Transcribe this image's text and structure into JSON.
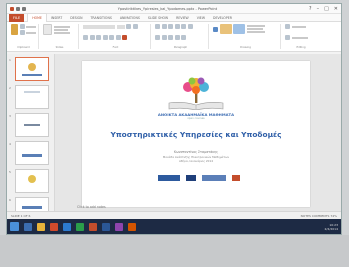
{
  "window": {
    "title": "Ypostiriktikes_Ypiresies_kai_Ypodomes.pptx - PowerPoint",
    "controls": [
      "?",
      "–",
      "□",
      "✕"
    ]
  },
  "ribbon": {
    "tabs": [
      "FILE",
      "HOME",
      "INSERT",
      "DESIGN",
      "TRANSITIONS",
      "ANIMATIONS",
      "SLIDE SHOW",
      "REVIEW",
      "VIEW",
      "DEVELOPER"
    ],
    "active_tab": "HOME",
    "groups": [
      "Clipboard",
      "Slides",
      "Font",
      "Paragraph",
      "Drawing",
      "Editing"
    ]
  },
  "thumbnails": [
    "1",
    "2",
    "3",
    "4",
    "5",
    "6"
  ],
  "slide": {
    "logo_text": "ΑΝΟΙΚΤΑ ΑΚΑΔΗΜΑΪΚΑ ΜΑΘΗΜΑΤΑ",
    "logo_sub": "open courses",
    "title": "Υποστηρικτικές Υπηρεσίες και Υποδομές",
    "subtitle_1": "Κωνσταντίνος Σταματάκης",
    "subtitle_2": "Μονάδα Ανάπτυξης Ηλεκτρονικών Μαθημάτων",
    "subtitle_3": "Αθήνα, Ιανουάριος 2014",
    "notes_placeholder": "Click to add notes"
  },
  "status": {
    "left": "SLIDE 1 OF 6",
    "right": "NOTES   COMMENTS   74%"
  },
  "taskbar": {
    "time": "10:23",
    "date": "2/4/2014"
  },
  "colors": {
    "accent": "#c44d2c",
    "title_blue": "#2f5fa8"
  }
}
